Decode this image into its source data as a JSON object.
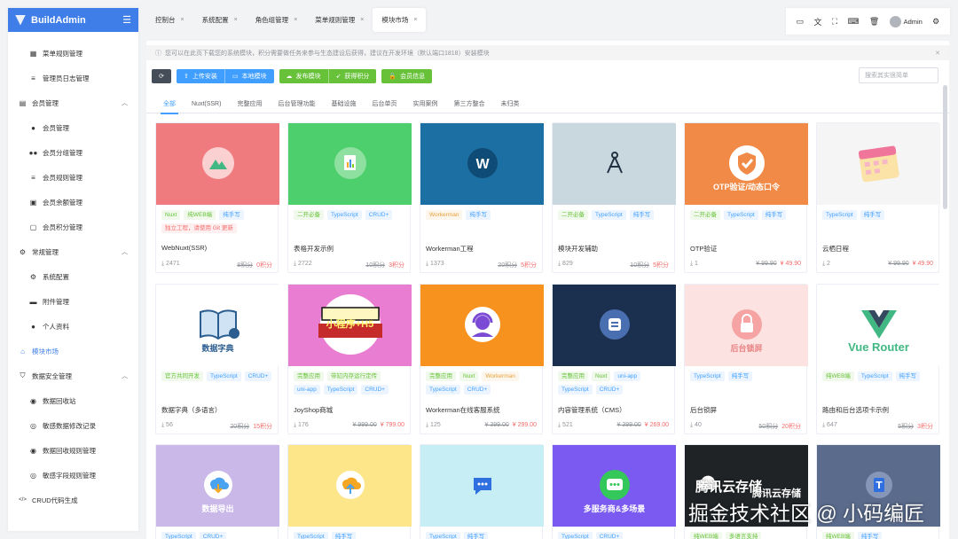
{
  "app": {
    "name": "BuildAdmin",
    "accent": "#3f7ee8"
  },
  "sidebar": {
    "items": [
      {
        "label": "菜单规则管理",
        "icon": "grid-icon",
        "type": "sub"
      },
      {
        "label": "管理员日志管理",
        "icon": "list-icon",
        "type": "sub"
      },
      {
        "label": "会员管理",
        "icon": "id-card-icon",
        "type": "group",
        "chevron": "︿"
      },
      {
        "label": "会员管理",
        "icon": "user-icon",
        "type": "sub"
      },
      {
        "label": "会员分组管理",
        "icon": "users-icon",
        "type": "sub"
      },
      {
        "label": "会员规则管理",
        "icon": "list-icon",
        "type": "sub"
      },
      {
        "label": "会员余额管理",
        "icon": "money-icon",
        "type": "sub"
      },
      {
        "label": "会员积分管理",
        "icon": "clipboard-icon",
        "type": "sub"
      },
      {
        "label": "常规管理",
        "icon": "gears-icon",
        "type": "group",
        "chevron": "︿"
      },
      {
        "label": "系统配置",
        "icon": "gear-icon",
        "type": "sub"
      },
      {
        "label": "附件管理",
        "icon": "folder-icon",
        "type": "sub"
      },
      {
        "label": "个人资料",
        "icon": "user-icon",
        "type": "sub"
      },
      {
        "label": "模块市场",
        "icon": "store-icon",
        "type": "active"
      },
      {
        "label": "数据安全管理",
        "icon": "shield-icon",
        "type": "group",
        "chevron": "︿"
      },
      {
        "label": "数据回收站",
        "icon": "database-icon",
        "type": "sub"
      },
      {
        "label": "敏感数据修改记录",
        "icon": "eye-icon",
        "type": "sub"
      },
      {
        "label": "数据回收规则管理",
        "icon": "database-icon",
        "type": "sub"
      },
      {
        "label": "敏感字段规则管理",
        "icon": "eye-icon",
        "type": "sub"
      },
      {
        "label": "CRUD代码生成",
        "icon": "code-icon",
        "type": "group"
      }
    ]
  },
  "tabs": [
    {
      "label": "控制台",
      "active": false
    },
    {
      "label": "系统配置",
      "active": false
    },
    {
      "label": "角色组管理",
      "active": false
    },
    {
      "label": "菜单规则管理",
      "active": false
    },
    {
      "label": "模块市场",
      "active": true
    }
  ],
  "topbar": {
    "user": "Admin"
  },
  "notice": "您可以在此页下载您的系统模块，积分需要做任务来参与生态建设后获得，建议在开发环境（默认端口1818）安装模块",
  "toolbar": {
    "upload": "上传安装",
    "local": "本地模块",
    "publish": "发布模块",
    "points": "获得积分",
    "member": "会员信息",
    "search_placeholder": "搜索其实很简单"
  },
  "categories": [
    "全部",
    "Nuxt(SSR)",
    "完整应用",
    "后台管理功能",
    "基础设施",
    "后台单页",
    "实用案例",
    "第三方整合",
    "未归类"
  ],
  "cards": [
    {
      "title": "WebNuxt(SSR)",
      "tags": [
        [
          "Nuxt",
          "g"
        ],
        [
          "纯WEB端",
          "g"
        ],
        [
          "纯手写",
          "b"
        ],
        [
          "独立工程，请使用 Git 更新",
          "r"
        ]
      ],
      "downloads": "2471",
      "old": "8积分",
      "price": "0积分",
      "bg": "#f07b7f",
      "icon": "mountain-icon"
    },
    {
      "title": "表格开发示例",
      "tags": [
        [
          "二开必备",
          "g"
        ],
        [
          "TypeScript",
          "b"
        ],
        [
          "CRUD+",
          "b"
        ]
      ],
      "downloads": "2722",
      "old": "10积分",
      "price": "3积分",
      "bg": "#4ccf6c",
      "icon": "report-icon"
    },
    {
      "title": "Workerman工程",
      "tags": [
        [
          "Workerman",
          "o"
        ],
        [
          "纯手写",
          "b"
        ]
      ],
      "downloads": "1373",
      "old": "20积分",
      "price": "5积分",
      "bg": "#1c6fa3",
      "icon": "workerman-icon"
    },
    {
      "title": "模块开发辅助",
      "tags": [
        [
          "二开必备",
          "g"
        ],
        [
          "TypeScript",
          "b"
        ],
        [
          "纯手写",
          "b"
        ]
      ],
      "downloads": "829",
      "old": "10积分",
      "price": "5积分",
      "bg": "#c9d8df",
      "icon": "compass-icon"
    },
    {
      "title": "OTP验证",
      "tags": [
        [
          "二开必备",
          "g"
        ],
        [
          "TypeScript",
          "b"
        ],
        [
          "纯手写",
          "b"
        ]
      ],
      "downloads": "1",
      "old": "¥ 99.90",
      "price": "¥ 49.90",
      "bg": "#f18a46",
      "icon": "shield-check-icon",
      "caption": "OTP验证/动态口令"
    },
    {
      "title": "云栖日程",
      "tags": [
        [
          "TypeScript",
          "b"
        ],
        [
          "纯手写",
          "b"
        ]
      ],
      "downloads": "2",
      "old": "¥ 99.90",
      "price": "¥ 49.90",
      "bg": "#f5f5f5",
      "icon": "calendar-icon"
    },
    {
      "title": "数据字典（多语言）",
      "tags": [
        [
          "官方共同开发",
          "g"
        ],
        [
          "TypeScript",
          "b"
        ],
        [
          "CRUD+",
          "b"
        ]
      ],
      "downloads": "56",
      "old": "20积分",
      "price": "15积分",
      "bg": "#ffffff",
      "icon": "book-icon",
      "caption": "数据字典"
    },
    {
      "title": "JoyShop商城",
      "tags": [
        [
          "完整应用",
          "g"
        ],
        [
          "带缸内存运行定传",
          "g"
        ],
        [
          "uni-app",
          "b"
        ],
        [
          "TypeScript",
          "b"
        ],
        [
          "CRUD+",
          "b"
        ]
      ],
      "downloads": "176",
      "old": "¥ 999.00",
      "price": "¥ 799.00",
      "bg": "#e97dd1",
      "icon": "shop-icon",
      "caption": "小程序+H5"
    },
    {
      "title": "Workerman在线客服系统",
      "tags": [
        [
          "完整应用",
          "g"
        ],
        [
          "Nuxt",
          "g"
        ],
        [
          "Workerman",
          "o"
        ],
        [
          "TypeScript",
          "b"
        ],
        [
          "CRUD+",
          "b"
        ]
      ],
      "downloads": "125",
      "old": "¥ 399.00",
      "price": "¥ 299.00",
      "bg": "#f7921e",
      "icon": "headset-icon"
    },
    {
      "title": "内容管理系统（CMS）",
      "tags": [
        [
          "完整应用",
          "g"
        ],
        [
          "Nuxt",
          "g"
        ],
        [
          "uni-app",
          "b"
        ],
        [
          "TypeScript",
          "b"
        ],
        [
          "CRUD+",
          "b"
        ]
      ],
      "downloads": "521",
      "old": "¥ 399.00",
      "price": "¥ 269.00",
      "bg": "#1b2f4f",
      "icon": "cms-icon"
    },
    {
      "title": "后台锁屏",
      "tags": [
        [
          "TypeScript",
          "b"
        ],
        [
          "纯手写",
          "b"
        ]
      ],
      "downloads": "40",
      "old": "50积分",
      "price": "20积分",
      "bg": "#fde2e2",
      "icon": "lock-icon",
      "caption": "后台锁屏"
    },
    {
      "title": "路由和后台选项卡示例",
      "tags": [
        [
          "纯WEB端",
          "g"
        ],
        [
          "TypeScript",
          "b"
        ],
        [
          "纯手写",
          "b"
        ]
      ],
      "downloads": "647",
      "old": "5积分",
      "price": "3积分",
      "bg": "#ffffff",
      "icon": "vue-icon",
      "caption": "Vue Router"
    },
    {
      "title": "",
      "tags": [
        [
          "TypeScript",
          "b"
        ],
        [
          "CRUD+",
          "b"
        ]
      ],
      "downloads": "",
      "old": "",
      "price": "",
      "bg": "#c9b8e8",
      "icon": "cloud-download-icon",
      "caption": "数据导出"
    },
    {
      "title": "",
      "tags": [
        [
          "TypeScript",
          "b"
        ],
        [
          "纯手写",
          "b"
        ]
      ],
      "downloads": "",
      "old": "",
      "price": "",
      "bg": "#fde68a",
      "icon": "cloud-upload-icon"
    },
    {
      "title": "",
      "tags": [
        [
          "TypeScript",
          "b"
        ],
        [
          "纯手写",
          "b"
        ]
      ],
      "downloads": "",
      "old": "",
      "price": "",
      "bg": "#c7eef5",
      "icon": "chat-icon"
    },
    {
      "title": "",
      "tags": [
        [
          "TypeScript",
          "b"
        ],
        [
          "CRUD+",
          "b"
        ]
      ],
      "downloads": "",
      "old": "",
      "price": "",
      "bg": "#7a5af0",
      "icon": "message-icon",
      "caption": "多服务商&多场景"
    },
    {
      "title": "",
      "tags": [
        [
          "纯WEB端",
          "g"
        ],
        [
          "多语言支持",
          "g"
        ]
      ],
      "downloads": "",
      "old": "",
      "price": "",
      "bg": "#1f2326",
      "icon": "cloud-icon",
      "caption": "腾讯云存储"
    },
    {
      "title": "",
      "tags": [
        [
          "纯WEB端",
          "g"
        ],
        [
          "纯手写",
          "b"
        ]
      ],
      "downloads": "",
      "old": "",
      "price": "",
      "bg": "#5a6b8c",
      "icon": "doc-icon"
    }
  ],
  "watermark": {
    "line1": "腾讯云存储",
    "line2": "掘金技术社区 @ 小码编匠"
  }
}
